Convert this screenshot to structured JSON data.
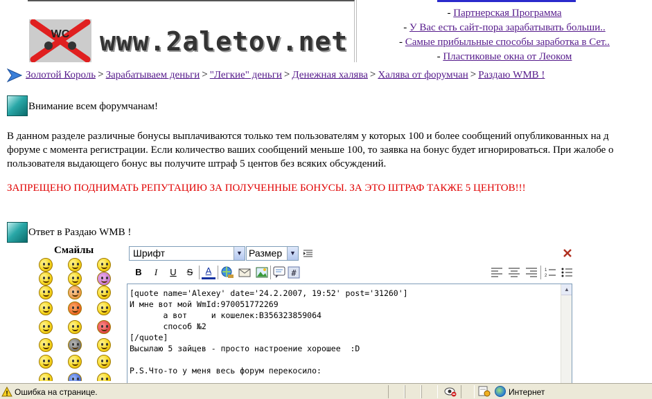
{
  "header": {
    "logo_text": "www.2aletov.net",
    "logo_badge": "WC",
    "top_links": [
      "Партнерская Программа",
      "У Вас есть сайт-пора зарабатывать больши..",
      "Самые прибыльные способы заработка в Сет..",
      "Пластиковые окна от Леоком"
    ],
    "link_prefix": "- "
  },
  "breadcrumb": {
    "items": [
      "Золотой Король",
      "Зарабатываем деньги",
      "\"Легкие\" деньги",
      "Денежная халява",
      "Халява от форумчан",
      "Раздаю WMB !"
    ],
    "separator": ">"
  },
  "notice": {
    "title": "Внимание всем форумчанам!",
    "body_lines": [
      "В данном разделе различные бонусы выплачиваются только тем пользователям у которых 100 и более сообщений опубликованных на д",
      "форуме с момента регистрации. Если количество ваших сообщений меньше 100, то заявка на бонус будет игнорироваться. При жалобе о",
      "пользователя выдающего бонус вы получите штраф 5 центов без всяких обсуждений."
    ],
    "warning": "ЗАПРЕЩЕНО ПОДНИМАТЬ РЕПУТАЦИЮ ЗА ПОЛУЧЕННЫЕ БОНУСЫ. ЗА ЭТО ШТРАФ ТАКЖЕ 5 ЦЕНТОВ!!!",
    "warning_color": "#e00000"
  },
  "reply": {
    "title": "Ответ в Раздаю WMB !"
  },
  "smilies": {
    "title": "Смайлы"
  },
  "editor": {
    "font_select": "Шрифт",
    "size_select": "Размер",
    "buttons": {
      "bold": "B",
      "italic": "I",
      "underline": "U",
      "strike": "S",
      "color": "A"
    },
    "text": "[quote name='Alexey' date='24.2.2007, 19:52' post='31260']\nИ мне вот мой WmId:970051772269\n       а вот     и кошелек:B356323859064\n       способ №2\n[/quote]\nВысылаю 5 зайцев - просто настроение хорошее  :D\n\nP.S.Что-то у меня весь форум перекосило:"
  },
  "statusbar": {
    "message": "Ошибка на странице.",
    "zone": "Интернет"
  },
  "colors": {
    "link": "#551a8b",
    "teal": "#2aa8a8",
    "statusbar_bg": "#ece9d8"
  }
}
